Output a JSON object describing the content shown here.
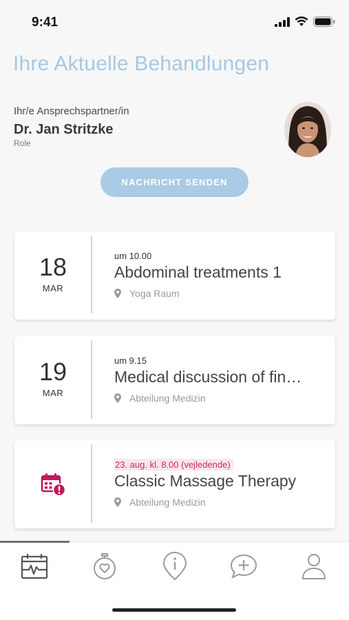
{
  "status_bar": {
    "time": "9:41"
  },
  "header": {
    "title": "Ihre Aktuelle Behandlungen"
  },
  "contact": {
    "caption": "Ihr/e Ansprechspartner/in",
    "name": "Dr. Jan Stritzke",
    "role": "Role"
  },
  "actions": {
    "send_message_label": "NACHRICHT SENDEN"
  },
  "appointments": [
    {
      "day": "18",
      "month": "MAR",
      "time": "um 10.00",
      "title": "Abdominal treatments 1",
      "location": "Yoga Raum"
    },
    {
      "day": "19",
      "month": "MAR",
      "time": "um 9.15",
      "title": "Medical discussion of fin…",
      "location": "Abteilung Medizin"
    },
    {
      "icon": "calendar-alert-icon",
      "time": "23. aug. kl. 8.00 (vejledende)",
      "title": "Classic Massage Therapy",
      "location": "Abteilung Medizin"
    }
  ],
  "tab_bar": {
    "tabs": [
      {
        "icon": "calendar-pulse-icon",
        "active": true
      },
      {
        "icon": "stopwatch-heart-icon",
        "active": false
      },
      {
        "icon": "info-pin-icon",
        "active": false
      },
      {
        "icon": "chat-plus-icon",
        "active": false
      },
      {
        "icon": "person-icon",
        "active": false
      }
    ]
  },
  "colors": {
    "accent": "#a6c8e4",
    "warning": "#c82a5a",
    "warning_bg": "#fbe6ec",
    "text": "#3a3a3a"
  }
}
